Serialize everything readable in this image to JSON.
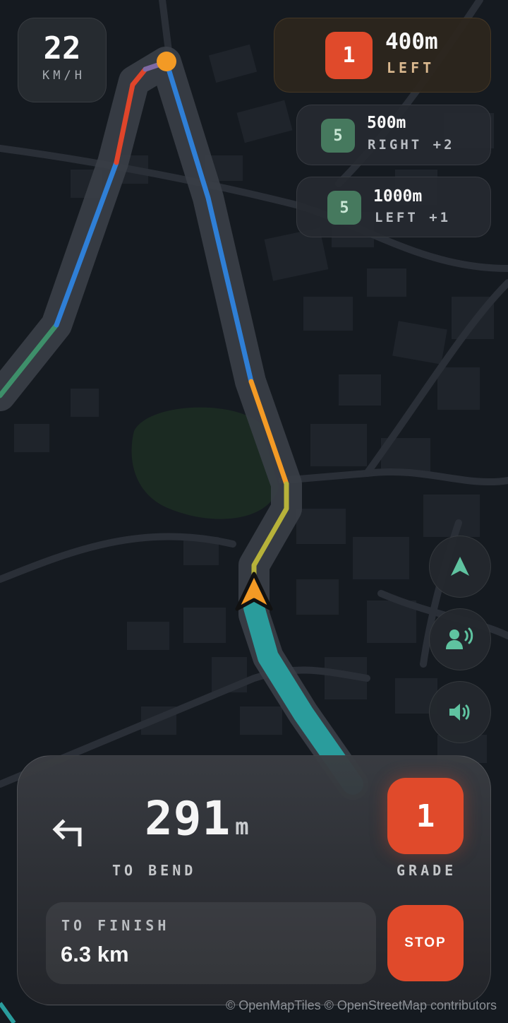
{
  "speed": {
    "value": "22",
    "unit": "KM/H"
  },
  "turns": [
    {
      "grade": "1",
      "distance": "400m",
      "direction": "LEFT",
      "grade_color": "#e04a2b"
    },
    {
      "grade": "5",
      "distance": "500m",
      "direction": "RIGHT +2",
      "grade_color": "#46795e"
    },
    {
      "grade": "5",
      "distance": "1000m",
      "direction": "LEFT +1",
      "grade_color": "#46795e"
    }
  ],
  "controls": {
    "recenter_icon": "navigation-arrow-icon",
    "voice_icon": "voice-guidance-icon",
    "sound_icon": "volume-icon"
  },
  "next_bend": {
    "distance_value": "291",
    "distance_unit": "m",
    "label": "TO BEND",
    "turn_icon": "turn-left-arrow-icon",
    "grade": "1",
    "grade_label": "GRADE"
  },
  "finish": {
    "label": "TO FINISH",
    "value": "6.3 km"
  },
  "stop_label": "STOP",
  "attribution": "© OpenMapTiles © OpenStreetMap contributors",
  "colors": {
    "accent_red": "#e04a2b",
    "accent_green": "#46795e",
    "route_blue": "#2f7fd6",
    "route_orange": "#f39a25",
    "route_teal": "#2a9c9c",
    "position_marker": "#f39a25"
  }
}
